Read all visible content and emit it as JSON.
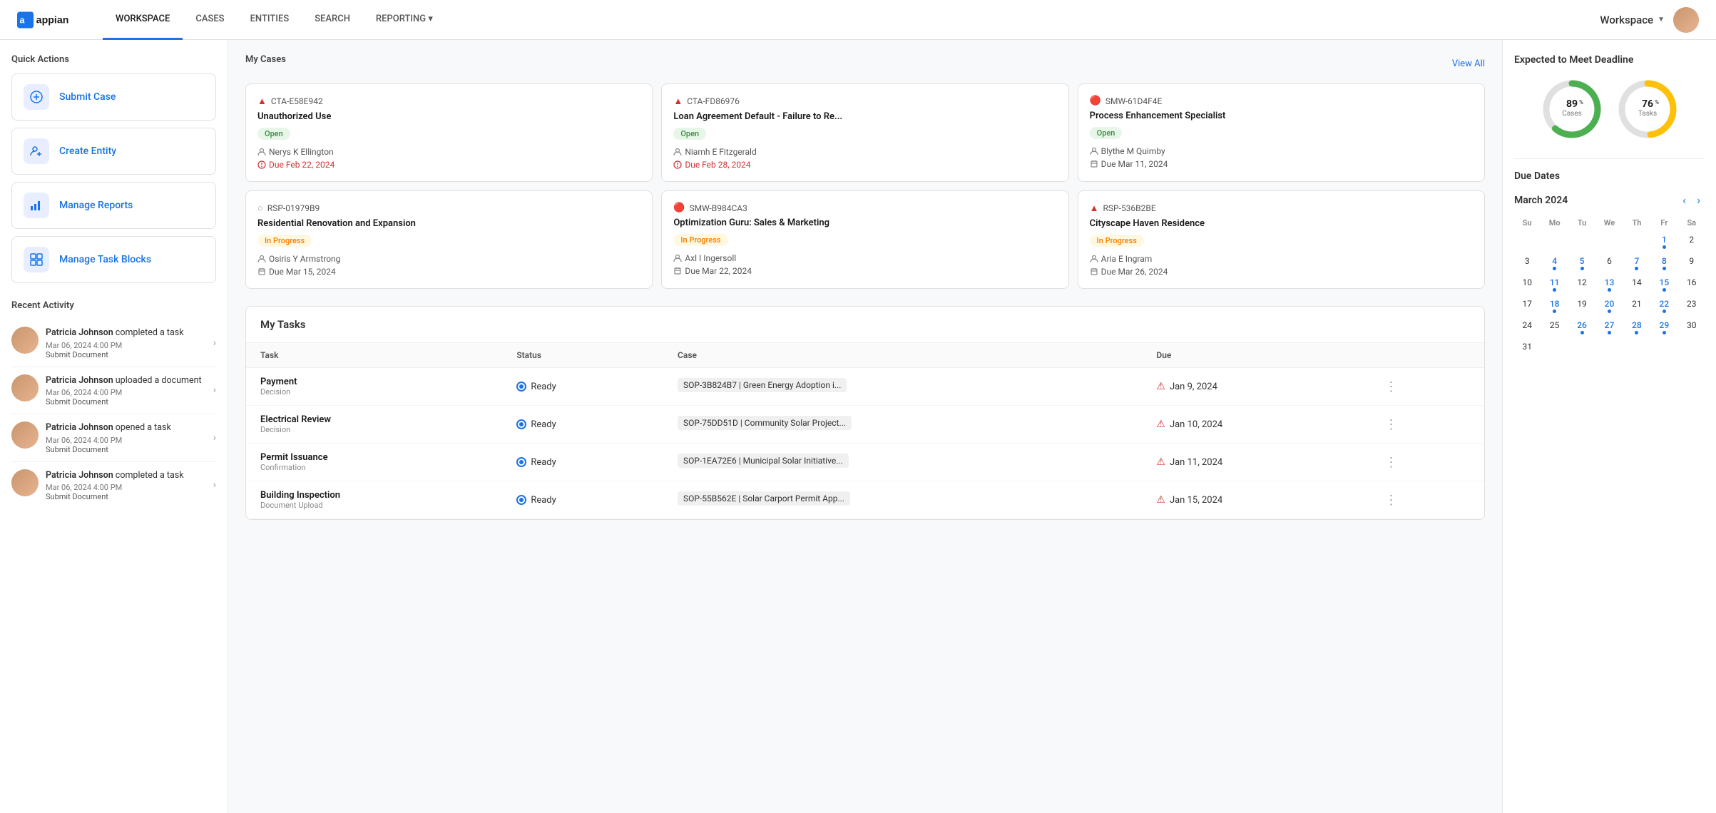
{
  "nav": {
    "logo_text": "appian",
    "links": [
      "WORKSPACE",
      "CASES",
      "ENTITIES",
      "SEARCH",
      "REPORTING"
    ],
    "active_link": "WORKSPACE",
    "workspace_label": "Workspace",
    "reporting_has_dropdown": true
  },
  "quick_actions": {
    "title": "Quick Actions",
    "items": [
      {
        "id": "submit-case",
        "label": "Submit Case",
        "icon": "+"
      },
      {
        "id": "create-entity",
        "label": "Create Entity",
        "icon": "👤"
      },
      {
        "id": "manage-reports",
        "label": "Manage Reports",
        "icon": "📊"
      },
      {
        "id": "manage-task-blocks",
        "label": "Manage Task Blocks",
        "icon": "⊞"
      }
    ]
  },
  "recent_activity": {
    "title": "Recent Activity",
    "items": [
      {
        "user": "Patricia Johnson",
        "action": "completed a task",
        "time": "Mar 06, 2024 4:00 PM",
        "doc": "Submit Document"
      },
      {
        "user": "Patricia Johnson",
        "action": "uploaded a document",
        "time": "Mar 06, 2024 4:00 PM",
        "doc": "Submit Document"
      },
      {
        "user": "Patricia Johnson",
        "action": "opened a task",
        "time": "Mar 06, 2024 4:00 PM",
        "doc": "Submit Document"
      },
      {
        "user": "Patricia Johnson",
        "action": "completed a task",
        "time": "Mar 06, 2024 4:00 PM",
        "doc": "Submit Document"
      }
    ]
  },
  "my_cases": {
    "title": "My Cases",
    "view_all_label": "View All",
    "cases": [
      {
        "id": "CTA-E58E942",
        "title": "Unauthorized Use",
        "status": "Open",
        "status_type": "open",
        "assignee": "Nerys K Ellington",
        "due": "Due Feb 22, 2024",
        "due_overdue": true,
        "priority": "high"
      },
      {
        "id": "CTA-FD86976",
        "title": "Loan Agreement Default - Failure to Re...",
        "status": "Open",
        "status_type": "open",
        "assignee": "Niamh E Fitzgerald",
        "due": "Due Feb 28, 2024",
        "due_overdue": true,
        "priority": "high"
      },
      {
        "id": "SMW-61D4F4E",
        "title": "Process Enhancement Specialist",
        "status": "Open",
        "status_type": "open",
        "assignee": "Blythe M Quimby",
        "due": "Due Mar 11, 2024",
        "due_overdue": false,
        "priority": "fire"
      },
      {
        "id": "RSP-01979B9",
        "title": "Residential Renovation and Expansion",
        "status": "In Progress",
        "status_type": "progress",
        "assignee": "Osiris Y Armstrong",
        "due": "Due Mar 15, 2024",
        "due_overdue": false,
        "priority": "circle"
      },
      {
        "id": "SMW-B984CA3",
        "title": "Optimization Guru: Sales & Marketing",
        "status": "In Progress",
        "status_type": "progress",
        "assignee": "Axl I Ingersoll",
        "due": "Due Mar 22, 2024",
        "due_overdue": false,
        "priority": "fire"
      },
      {
        "id": "RSP-536B2BE",
        "title": "Cityscape Haven Residence",
        "status": "In Progress",
        "status_type": "progress",
        "assignee": "Aria E Ingram",
        "due": "Due Mar 26, 2024",
        "due_overdue": false,
        "priority": "high"
      }
    ]
  },
  "my_tasks": {
    "title": "My Tasks",
    "columns": [
      "Task",
      "Status",
      "Case",
      "Due"
    ],
    "rows": [
      {
        "name": "Payment",
        "type": "Decision",
        "status": "Ready",
        "case": "SOP-3B824B7 | Green Energy Adoption i...",
        "due": "Jan 9, 2024",
        "overdue": true
      },
      {
        "name": "Electrical Review",
        "type": "Decision",
        "status": "Ready",
        "case": "SOP-75DD51D | Community Solar Project...",
        "due": "Jan 10, 2024",
        "overdue": true
      },
      {
        "name": "Permit Issuance",
        "type": "Confirmation",
        "status": "Ready",
        "case": "SOP-1EA72E6 | Municipal Solar Initiative...",
        "due": "Jan 11, 2024",
        "overdue": true
      },
      {
        "name": "Building Inspection",
        "type": "Document Upload",
        "status": "Ready",
        "case": "SOP-55B562E | Solar Carport Permit App...",
        "due": "Jan 15, 2024",
        "overdue": true
      }
    ]
  },
  "expected_deadline": {
    "title": "Expected to Meet Deadline",
    "cases_pct": 89,
    "tasks_pct": 76,
    "cases_label": "Cases",
    "tasks_label": "Tasks"
  },
  "due_dates": {
    "title": "Due Dates",
    "month": "March 2024",
    "day_headers": [
      "Su",
      "Mo",
      "Tu",
      "We",
      "Th",
      "Fr",
      "Sa"
    ],
    "days": [
      {
        "num": "",
        "blank": true
      },
      {
        "num": "",
        "blank": true
      },
      {
        "num": "",
        "blank": true
      },
      {
        "num": "",
        "blank": true
      },
      {
        "num": "",
        "blank": true
      },
      {
        "num": 1,
        "blue": true,
        "dot": true
      },
      {
        "num": 2
      },
      {
        "num": 3
      },
      {
        "num": 4,
        "blue": true,
        "dot": true
      },
      {
        "num": 5,
        "blue": true,
        "dot": true
      },
      {
        "num": 6
      },
      {
        "num": 7,
        "blue": true,
        "dot": true
      },
      {
        "num": 8,
        "blue": true,
        "dot": true
      },
      {
        "num": 9
      },
      {
        "num": 10
      },
      {
        "num": 11,
        "blue": true,
        "dot": true
      },
      {
        "num": 12
      },
      {
        "num": 13,
        "blue": true,
        "dot": true
      },
      {
        "num": 14
      },
      {
        "num": 15,
        "blue": true,
        "dot": true
      },
      {
        "num": 16
      },
      {
        "num": 17
      },
      {
        "num": 18,
        "blue": true,
        "dot": true
      },
      {
        "num": 19
      },
      {
        "num": 20,
        "blue": true,
        "dot": true
      },
      {
        "num": 21
      },
      {
        "num": 22,
        "blue": true,
        "dot": true
      },
      {
        "num": 23
      },
      {
        "num": 24
      },
      {
        "num": 25
      },
      {
        "num": 26,
        "blue": true,
        "dot": true
      },
      {
        "num": 27,
        "blue": true,
        "dot": true
      },
      {
        "num": 28,
        "blue": true,
        "dot": true
      },
      {
        "num": 29,
        "blue": true,
        "dot": true
      },
      {
        "num": 30
      },
      {
        "num": 31
      },
      {
        "num": "",
        "blank": true
      },
      {
        "num": "",
        "blank": true
      },
      {
        "num": "",
        "blank": true
      },
      {
        "num": "",
        "blank": true
      },
      {
        "num": "",
        "blank": true
      },
      {
        "num": "",
        "blank": true
      }
    ]
  }
}
